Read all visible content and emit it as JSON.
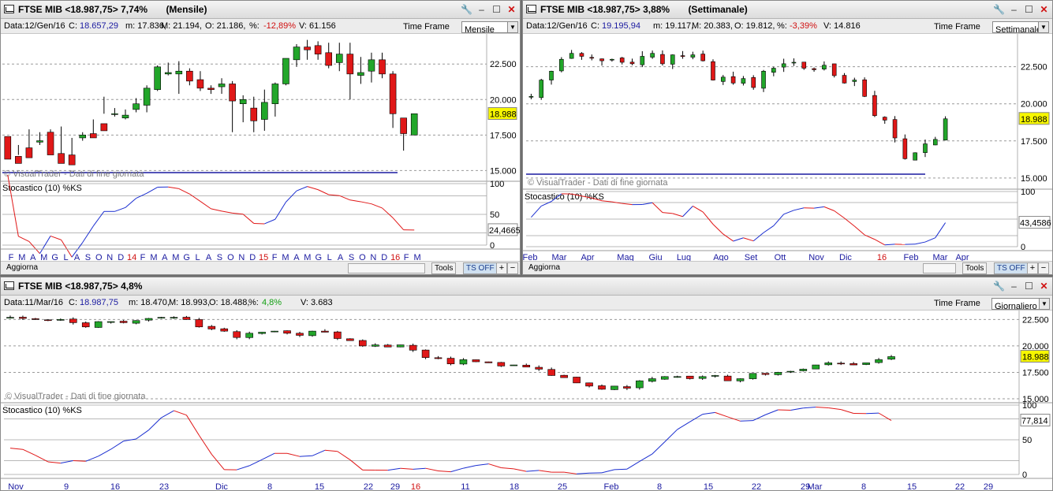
{
  "windows": [
    {
      "id": "monthly",
      "title": "FTSE MIB <18.987,75> 7,74%",
      "period_label": "(Mensile)",
      "info": {
        "date": "Data:12/Gen/16",
        "c_label": "C:",
        "c": "18.657,29",
        "m": "m: 17.836,",
        "M": "M: 21.194,",
        "o": "O: 21.186,",
        "pct_label": "%:",
        "pct": "-12,89%",
        "v": "V: 61.156"
      },
      "timeframe_label": "Time Frame",
      "timeframe_value": "Mensile",
      "price_axis": [
        "22.500",
        "20.000",
        "17.500",
        "15.000"
      ],
      "last_price": "18.988",
      "watermark": "© VisualTrader - Dati di fine giornata",
      "indicator_label": "Stocastico (10) %KS",
      "indicator_axis": [
        "100",
        "50",
        "0"
      ],
      "indicator_value": "24,4665",
      "x_labels": [
        "F",
        "M",
        "A",
        "M",
        "G",
        "L",
        "A",
        "S",
        "O",
        "N",
        "D",
        "14",
        "F",
        "M",
        "A",
        "M",
        "G",
        "L",
        "A",
        "S",
        "O",
        "N",
        "D",
        "15",
        "F",
        "M",
        "A",
        "M",
        "G",
        "L",
        "A",
        "S",
        "O",
        "N",
        "D",
        "16",
        "F",
        "M"
      ],
      "year_labels": [
        "14",
        "15",
        "16"
      ],
      "footer": {
        "update": "Aggiorna",
        "tools": "Tools",
        "ts": "TS OFF",
        "plus": "+",
        "minus": "−"
      }
    },
    {
      "id": "weekly",
      "title": "FTSE MIB <18.987,75> 3,88%",
      "period_label": "(Settimanale)",
      "info": {
        "date": "Data:12/Gen/16",
        "c_label": "C:",
        "c": "19.195,94",
        "m": "m: 19.117,",
        "M": "M: 20.383,",
        "o": "O: 19.812,",
        "pct_label": "%:",
        "pct": "-3,39%",
        "v": "V: 14.816"
      },
      "timeframe_label": "Time Frame",
      "timeframe_value": "Settimanale",
      "price_axis": [
        "22.500",
        "20.000",
        "17.500",
        "15.000"
      ],
      "last_price": "18.988",
      "watermark": "© VisualTrader - Dati di fine giornata",
      "indicator_label": "Stocastico (10) %KS",
      "indicator_axis": [
        "100",
        "0"
      ],
      "indicator_value": "43,4586",
      "x_labels": [
        "Feb",
        "Mar",
        "Apr",
        "Mag",
        "Giu",
        "Lug",
        "Ago",
        "Set",
        "Ott",
        "Nov",
        "Dic",
        "16",
        "Feb",
        "Mar",
        "Apr"
      ],
      "year_labels": [
        "16"
      ],
      "footer": {
        "update": "Aggiorna",
        "tools": "Tools",
        "ts": "TS OFF",
        "plus": "+",
        "minus": "−"
      }
    },
    {
      "id": "daily",
      "title": "FTSE MIB <18.987,75> 4,8%",
      "period_label": "",
      "info": {
        "date": "Data:11/Mar/16",
        "c_label": "C:",
        "c": "18.987,75",
        "m": "m: 18.470,",
        "M": "M: 18.993,",
        "o": "O: 18.488,",
        "pct_label": "%:",
        "pct": "4,8%",
        "v": "V: 3.683"
      },
      "timeframe_label": "Time Frame",
      "timeframe_value": "Giornaliero",
      "price_axis": [
        "22.500",
        "20.000",
        "17.500",
        "15.000"
      ],
      "last_price": "18.988",
      "watermark": "© VisualTrader - Dati di fine giornata",
      "indicator_label": "Stocastico (10) %KS",
      "indicator_axis": [
        "100",
        "50",
        "0"
      ],
      "indicator_value": "77,814",
      "x_labels": [
        "Nov",
        "9",
        "16",
        "23",
        "Dic",
        "8",
        "15",
        "22",
        "29",
        "16",
        "11",
        "18",
        "25",
        "Feb",
        "8",
        "15",
        "22",
        "29",
        "Mar",
        "8",
        "15",
        "22",
        "29"
      ],
      "year_labels": [
        "16"
      ]
    }
  ],
  "icons": {
    "tools": "wrench-icon",
    "minimize": "minimize-icon",
    "maximize": "maximize-icon",
    "close": "close-icon",
    "window": "chart-window-icon"
  },
  "colors": {
    "up": "#22a62a",
    "down": "#e01818",
    "stoch_up": "#1a2ed0",
    "stoch_down": "#e01818",
    "last_price_bg": "#f6f600",
    "baseline": "#1a1aa0"
  },
  "chart_data": [
    {
      "type": "candlestick",
      "title": "FTSE MIB (Mensile)",
      "ylim": [
        14500,
        24500
      ],
      "x": [
        "F",
        "M",
        "A",
        "M",
        "G",
        "L",
        "A",
        "S",
        "O",
        "N",
        "D",
        "14",
        "F",
        "M",
        "A",
        "M",
        "G",
        "L",
        "A",
        "S",
        "O",
        "N",
        "D",
        "15",
        "F",
        "M",
        "A",
        "M",
        "G",
        "L",
        "A",
        "S",
        "O",
        "N",
        "D",
        "16",
        "F",
        "M"
      ],
      "series": [
        {
          "name": "FTSE MIB",
          "ohlc": [
            [
              17400,
              16000,
              17400,
              15800
            ],
            [
              16000,
              16800,
              16100,
              15500
            ],
            [
              16600,
              17900,
              16500,
              15900
            ],
            [
              17000,
              17700,
              16800,
              17100
            ],
            [
              17700,
              17900,
              16300,
              16100
            ],
            [
              16200,
              18100,
              16100,
              15500
            ],
            [
              16100,
              17300,
              16000,
              15400
            ],
            [
              17300,
              17700,
              17100,
              17500
            ],
            [
              17600,
              18600,
              17600,
              17300
            ],
            [
              18300,
              20200,
              19000,
              17800
            ],
            [
              19000,
              19400,
              18800,
              19000
            ],
            [
              18700,
              19300,
              18600,
              18900
            ],
            [
              19300,
              20100,
              19100,
              19700
            ],
            [
              19600,
              21000,
              19100,
              20800
            ],
            [
              20700,
              22400,
              20600,
              22300
            ],
            [
              21800,
              22600,
              21700,
              21900
            ],
            [
              21800,
              22700,
              20400,
              22000
            ],
            [
              22000,
              22200,
              21000,
              21300
            ],
            [
              21400,
              22000,
              20600,
              20800
            ],
            [
              20800,
              21000,
              20400,
              20700
            ],
            [
              20900,
              21500,
              20400,
              21100
            ],
            [
              21100,
              21300,
              17700,
              19900
            ],
            [
              19700,
              20300,
              18400,
              20000
            ],
            [
              19400,
              20200,
              17700,
              18500
            ],
            [
              18600,
              20700,
              17800,
              19800
            ],
            [
              19700,
              21200,
              18800,
              21100
            ],
            [
              21100,
              22900,
              21000,
              22900
            ],
            [
              22800,
              23900,
              22300,
              23700
            ],
            [
              23700,
              24200,
              22800,
              23500
            ],
            [
              23800,
              24100,
              22800,
              23200
            ],
            [
              23300,
              24000,
              22200,
              22400
            ],
            [
              22600,
              24000,
              22000,
              23200
            ],
            [
              23200,
              24000,
              20000,
              21800
            ],
            [
              21700,
              23000,
              21100,
              21900
            ],
            [
              22000,
              23300,
              21200,
              22800
            ],
            [
              22800,
              23300,
              21500,
              21800
            ],
            [
              21800,
              22000,
              18000,
              19000
            ],
            [
              18700,
              18700,
              16400,
              17600
            ],
            [
              17500,
              19000,
              17500,
              19000
            ]
          ]
        }
      ],
      "indicator": {
        "name": "Stocastico (10) %KS",
        "ylim": [
          0,
          100
        ],
        "last": 24.4665
      }
    },
    {
      "type": "candlestick",
      "title": "FTSE MIB (Settimanale)",
      "ylim": [
        14500,
        24500
      ],
      "x": [
        "Feb",
        "Mar",
        "Apr",
        "Mag",
        "Giu",
        "Lug",
        "Ago",
        "Set",
        "Ott",
        "Nov",
        "Dic",
        "16",
        "Feb",
        "Mar",
        "Apr"
      ],
      "series": [
        {
          "name": "FTSE MIB",
          "last_close": 18988
        }
      ],
      "indicator": {
        "name": "Stocastico (10) %KS",
        "ylim": [
          0,
          100
        ],
        "last": 43.4586
      }
    },
    {
      "type": "candlestick",
      "title": "FTSE MIB (Giornaliero)",
      "ylim": [
        14500,
        23000
      ],
      "x": [
        "Nov",
        "9",
        "16",
        "23",
        "Dic",
        "8",
        "15",
        "22",
        "29",
        "16",
        "11",
        "18",
        "25",
        "Feb",
        "8",
        "15",
        "22",
        "29",
        "Mar",
        "8",
        "15",
        "22",
        "29"
      ],
      "series": [
        {
          "name": "FTSE MIB",
          "last_close": 18987.75
        }
      ],
      "indicator": {
        "name": "Stocastico (10) %KS",
        "ylim": [
          0,
          100
        ],
        "last": 77.814
      }
    }
  ]
}
